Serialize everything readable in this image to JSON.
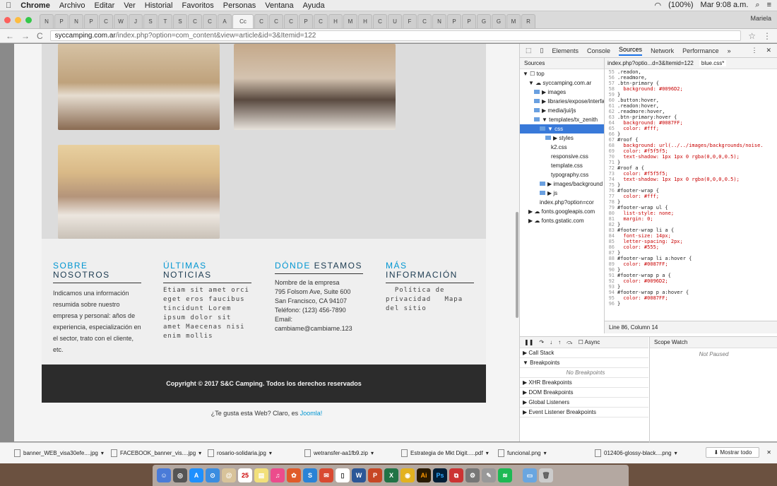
{
  "menubar": {
    "app": "Chrome",
    "items": [
      "Archivo",
      "Editar",
      "Ver",
      "Historial",
      "Favoritos",
      "Personas",
      "Ventana",
      "Ayuda"
    ],
    "battery": "(100%)",
    "clock": "Mar 9:08 a.m."
  },
  "tabs": {
    "labels": [
      "N",
      "P",
      "N",
      "P",
      "C",
      "W",
      "J",
      "S",
      "T",
      "S",
      "C",
      "C",
      "A",
      "C",
      "C",
      "C",
      "P",
      "C",
      "H",
      "M",
      "H",
      "C",
      "U",
      "F",
      "C",
      "N",
      "P",
      "P",
      "G",
      "G",
      "M",
      "R"
    ],
    "active_label": "Cc",
    "profile": "Mariela"
  },
  "address": {
    "host": "syccamping.com.ar",
    "path": "/index.php?option=com_content&view=article&id=3&Itemid=122"
  },
  "footer": {
    "col1": {
      "title_a": "SOBRE",
      "title_b": " NOSOTROS",
      "text": "Indicamos una información resumida sobre nuestro empresa y personal: años de experiencia, especialización en el sector, trato con el cliente, etc."
    },
    "col2": {
      "title_a": "ÚLTIMAS",
      "title_b": "NOTICIAS",
      "text": "Etiam sit amet orci eget eros faucibus tincidunt Lorem ipsum dolor sit amet Maecenas nisi enim mollis"
    },
    "col3": {
      "title_a": "DÓNDE",
      "title_b": " ESTAMOS",
      "lines": [
        "Nombre de la empresa",
        "795 Folsom Ave, Suite 600",
        "San Francisco, CA 94107",
        "Teléfono: (123) 456-7890",
        "Email:",
        "cambiame@cambiame.123"
      ]
    },
    "col4": {
      "title_a": "MÁS",
      "title_b": "INFORMACIÓN",
      "text": "  Política de privacidad   Mapa del sitio"
    }
  },
  "copyright": "Copyright © 2017 S&C Camping. Todos los derechos reservados",
  "credit": {
    "text": "¿Te gusta esta Web? Claro, es ",
    "link": "Joomla!"
  },
  "devtools": {
    "tabs": [
      "Elements",
      "Console",
      "Sources",
      "Network",
      "Performance"
    ],
    "nav_header": "Sources",
    "tree": [
      {
        "t": "▼ ☐ top",
        "d": 0
      },
      {
        "t": "▼ ☁ syccamping.com.ar",
        "d": 1
      },
      {
        "t": "▶ images",
        "d": 2,
        "f": 1
      },
      {
        "t": "▶ libraries/expose/interfa",
        "d": 2,
        "f": 1
      },
      {
        "t": "▶ media/jui/js",
        "d": 2,
        "f": 1
      },
      {
        "t": "▼ templates/tx_zenith",
        "d": 2,
        "f": 1
      },
      {
        "t": "▼ css",
        "d": 3,
        "f": 1,
        "hl": 1
      },
      {
        "t": "▶ styles",
        "d": 4,
        "f": 1
      },
      {
        "t": "k2.css",
        "d": 5
      },
      {
        "t": "responsive.css",
        "d": 5
      },
      {
        "t": "template.css",
        "d": 5
      },
      {
        "t": "typography.css",
        "d": 5
      },
      {
        "t": "▶ images/background",
        "d": 3,
        "f": 1
      },
      {
        "t": "▶ js",
        "d": 3,
        "f": 1
      },
      {
        "t": "index.php?option=cor",
        "d": 3
      },
      {
        "t": "▶ ☁ fonts.googleapis.com",
        "d": 1
      },
      {
        "t": "▶ ☁ fonts.gstatic.com",
        "d": 1
      }
    ],
    "editor_tabs": [
      "index.php?optio...d=3&Itemid=122",
      "blue.css*"
    ],
    "code": [
      [
        "55",
        ".readon,"
      ],
      [
        "56",
        ".readmore,"
      ],
      [
        "57",
        ".btn-primary {"
      ],
      [
        "58",
        "  background: #0096D2;"
      ],
      [
        "59",
        "}"
      ],
      [
        "60",
        ".button:hover,"
      ],
      [
        "61",
        ".readon:hover,"
      ],
      [
        "62",
        ".readmore:hover,"
      ],
      [
        "63",
        ".btn-primary:hover {"
      ],
      [
        "64",
        "  background: #0087FF;"
      ],
      [
        "65",
        "  color: #fff;"
      ],
      [
        "66",
        "}"
      ],
      [
        "67",
        "#roof {"
      ],
      [
        "68",
        "  background: url(../../images/backgrounds/noise."
      ],
      [
        "69",
        "  color: #f5f5f5;"
      ],
      [
        "70",
        "  text-shadow: 1px 1px 0 rgba(0,0,0,0.5);"
      ],
      [
        "71",
        "}"
      ],
      [
        "72",
        "#roof a {"
      ],
      [
        "73",
        "  color: #f5f5f5;"
      ],
      [
        "74",
        "  text-shadow: 1px 1px 0 rgba(0,0,0,0.5);"
      ],
      [
        "75",
        "}"
      ],
      [
        "76",
        "#footer-wrap {"
      ],
      [
        "77",
        "  color: #fff;"
      ],
      [
        "78",
        "}"
      ],
      [
        "79",
        "#footer-wrap ul {"
      ],
      [
        "80",
        "  list-style: none;"
      ],
      [
        "81",
        "  margin: 0;"
      ],
      [
        "82",
        "}"
      ],
      [
        "83",
        "#footer-wrap li a {"
      ],
      [
        "84",
        "  font-size: 14px;"
      ],
      [
        "85",
        "  letter-spacing: 2px;"
      ],
      [
        "86",
        "  color: #555;"
      ],
      [
        "87",
        "}"
      ],
      [
        "88",
        "#footer-wrap li a:hover {"
      ],
      [
        "89",
        "  color: #0087FF;"
      ],
      [
        "90",
        "}"
      ],
      [
        "91",
        "#footer-wrap p a {"
      ],
      [
        "92",
        "  color: #0096D2;"
      ],
      [
        "93",
        "}"
      ],
      [
        "94",
        "#footer-wrap p a:hover {"
      ],
      [
        "95",
        "  color: #0087FF;"
      ],
      [
        "96",
        "}"
      ]
    ],
    "status": "Line 86, Column 14",
    "debug_sections": [
      "Call Stack",
      "Breakpoints",
      "No Breakpoints",
      "XHR Breakpoints",
      "DOM Breakpoints",
      "Global Listeners",
      "Event Listener Breakpoints"
    ],
    "async": "Async",
    "scope_tabs": "Scope  Watch",
    "not_paused": "Not Paused"
  },
  "downloads": {
    "items": [
      "banner_WEB_visa30efe....jpg",
      "FACEBOOK_banner_vis....jpg",
      "rosario-solidaria.jpg",
      "wetransfer-aa1fb9.zip",
      "Estrategia de Mkt Digit.....pdf",
      "funcional.png",
      "012406-glossy-black....png"
    ],
    "show_all": "Mostrar todo"
  },
  "dock": {
    "ai": "Ai",
    "ps": "Ps",
    "cal": "25"
  },
  "colors": {
    "accent": "#0096d2",
    "roof": "#2c2c2c"
  }
}
